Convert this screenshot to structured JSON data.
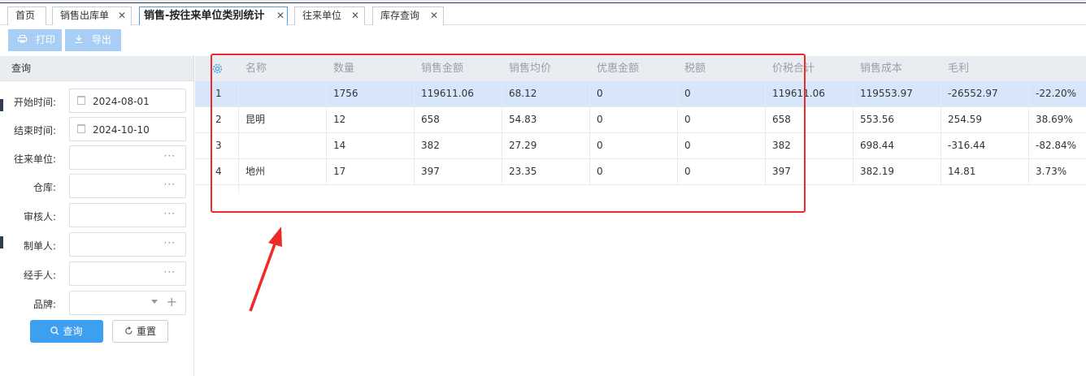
{
  "tabs": [
    {
      "label": "首页",
      "closable": false,
      "active": false
    },
    {
      "label": "销售出库单",
      "closable": true,
      "active": false
    },
    {
      "label": "销售-按往来单位类别统计",
      "closable": true,
      "active": true
    },
    {
      "label": "往来单位",
      "closable": true,
      "active": false
    },
    {
      "label": "库存查询",
      "closable": true,
      "active": false
    }
  ],
  "close_glyph": "✕",
  "toolbar": {
    "print_label": "打印",
    "export_label": "导出"
  },
  "query_panel": {
    "title": "查询",
    "fields": [
      {
        "label": "开始时间:",
        "value": "2024-08-01",
        "kind": "date"
      },
      {
        "label": "结束时间:",
        "value": "2024-10-10",
        "kind": "date"
      },
      {
        "label": "往来单位:",
        "value": "",
        "kind": "picker"
      },
      {
        "label": "仓库:",
        "value": "",
        "kind": "picker"
      },
      {
        "label": "审核人:",
        "value": "",
        "kind": "picker"
      },
      {
        "label": "制单人:",
        "value": "",
        "kind": "picker"
      },
      {
        "label": "经手人:",
        "value": "",
        "kind": "picker"
      },
      {
        "label": "品牌:",
        "value": "",
        "kind": "select"
      }
    ],
    "picker_glyph": "···",
    "plus_glyph": "+",
    "query_button": "查询",
    "reset_button": "重置"
  },
  "table": {
    "columns": [
      "名称",
      "数量",
      "销售金额",
      "销售均价",
      "优惠金额",
      "税额",
      "价税合计",
      "销售成本",
      "毛利",
      ""
    ],
    "rows": [
      [
        "1",
        "",
        "1756",
        "119611.06",
        "68.12",
        "0",
        "0",
        "119611.06",
        "119553.97",
        "-26552.97",
        "-22.20%"
      ],
      [
        "2",
        "昆明",
        "12",
        "658",
        "54.83",
        "0",
        "0",
        "658",
        "553.56",
        "254.59",
        "38.69%"
      ],
      [
        "3",
        "",
        "14",
        "382",
        "27.29",
        "0",
        "0",
        "382",
        "698.44",
        "-316.44",
        "-82.84%"
      ],
      [
        "4",
        "地州",
        "17",
        "397",
        "23.35",
        "0",
        "0",
        "397",
        "382.19",
        "14.81",
        "3.73%"
      ]
    ],
    "selected_row": 0
  },
  "colors": {
    "accent": "#3d9ff0",
    "toolbar_button": "#a9cef5",
    "selected_row": "#d7e6fb",
    "annotation": "#ee2a2a"
  },
  "icons": {
    "settings": "gear-icon",
    "print": "printer-icon",
    "export": "download-icon",
    "search": "search-icon",
    "reset": "refresh-icon",
    "date": "calendar-icon"
  }
}
